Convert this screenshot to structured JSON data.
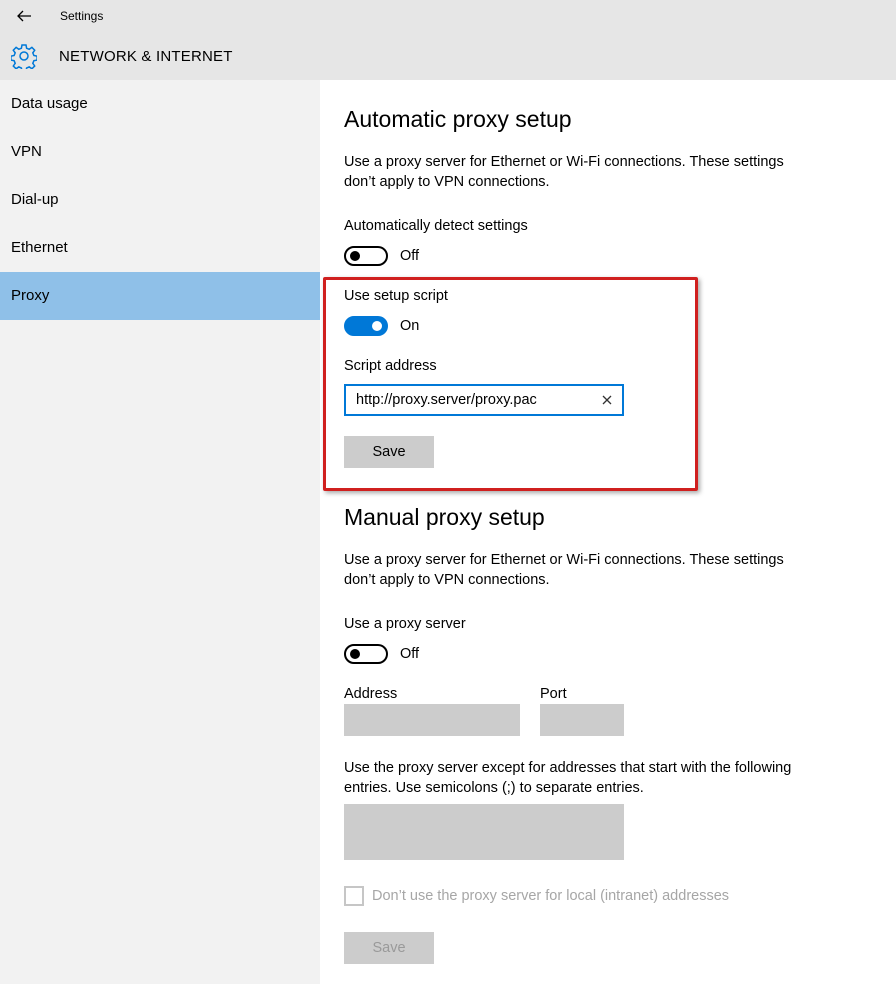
{
  "header": {
    "app_title": "Settings",
    "section_title": "NETWORK & INTERNET",
    "back_icon": "back-arrow-icon",
    "section_icon": "gear-icon"
  },
  "sidebar": {
    "items": [
      {
        "label": "Data usage",
        "selected": false
      },
      {
        "label": "VPN",
        "selected": false
      },
      {
        "label": "Dial-up",
        "selected": false
      },
      {
        "label": "Ethernet",
        "selected": false
      },
      {
        "label": "Proxy",
        "selected": true
      }
    ],
    "selected_color": "#8fc0e8"
  },
  "automatic": {
    "title": "Automatic proxy setup",
    "description": "Use a proxy server for Ethernet or Wi-Fi connections. These settings don’t apply to VPN connections.",
    "detect_label": "Automatically detect settings",
    "detect_state": "Off",
    "script_label": "Use setup script",
    "script_state": "On",
    "address_label": "Script address",
    "address_value": "http://proxy.server/proxy.pac",
    "save_label": "Save"
  },
  "manual": {
    "title": "Manual proxy setup",
    "description": "Use a proxy server for Ethernet or Wi-Fi connections. These settings don’t apply to VPN connections.",
    "use_proxy_label": "Use a proxy server",
    "use_proxy_state": "Off",
    "address_label": "Address",
    "port_label": "Port",
    "exceptions_description": "Use the proxy server except for addresses that start with the following entries. Use semicolons (;) to separate entries.",
    "local_checkbox_label": "Don’t use the proxy server for local (intranet) addresses",
    "save_label": "Save"
  },
  "colors": {
    "accent": "#0078d7",
    "highlight_border": "#d0201f"
  }
}
